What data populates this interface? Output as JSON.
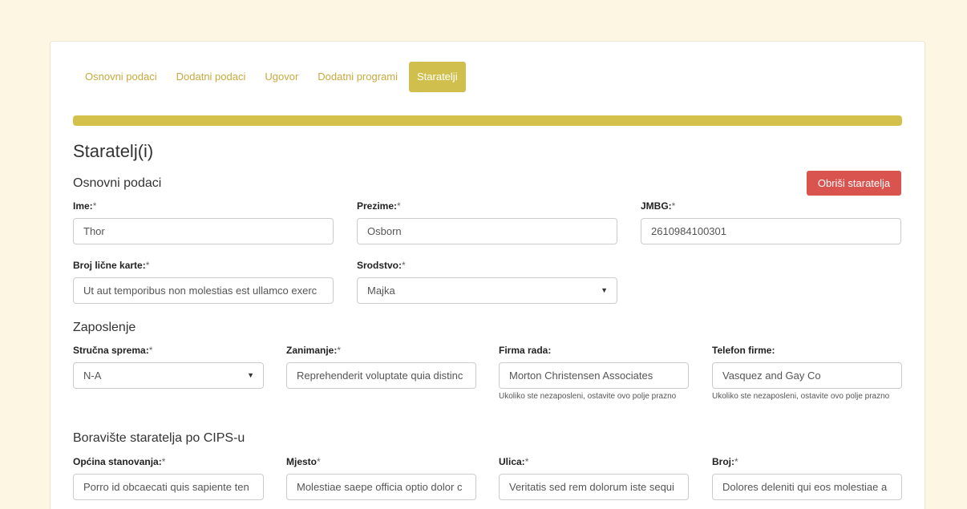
{
  "tabs": [
    {
      "label": "Osnovni podaci"
    },
    {
      "label": "Dodatni podaci"
    },
    {
      "label": "Ugovor"
    },
    {
      "label": "Dodatni programi"
    },
    {
      "label": "Staratelji"
    }
  ],
  "progress": {
    "value": 1.0
  },
  "page_title": "Staratelj(i)",
  "sections": {
    "basic": {
      "title": "Osnovni podaci",
      "delete_button": "Obriši staratelja",
      "ime": {
        "label": "Ime:",
        "req": "*",
        "value": "Thor"
      },
      "prezime": {
        "label": "Prezime:",
        "req": "*",
        "value": "Osborn"
      },
      "jmbg": {
        "label": "JMBG:",
        "req": "*",
        "value": "2610984100301"
      },
      "broj_licne": {
        "label": "Broj lične karte:",
        "req": "*",
        "value": "Ut aut temporibus non molestias est ullamco exerc"
      },
      "srodstvo": {
        "label": "Srodstvo:",
        "req": "*",
        "value": "Majka"
      }
    },
    "employment": {
      "title": "Zaposlenje",
      "strucna": {
        "label": "Stručna sprema:",
        "req": "*",
        "value": "N-A"
      },
      "zanimanje": {
        "label": "Zanimanje:",
        "req": "*",
        "value": "Reprehenderit voluptate quia distinc"
      },
      "firma": {
        "label": "Firma rada:",
        "value": "Morton Christensen Associates",
        "help": "Ukoliko ste nezaposleni, ostavite ovo polje prazno"
      },
      "telefon": {
        "label": "Telefon firme:",
        "value": "Vasquez and Gay Co",
        "help": "Ukoliko ste nezaposleni, ostavite ovo polje prazno"
      }
    },
    "residence": {
      "title": "Boravište staratelja po CIPS-u",
      "opcina": {
        "label": "Općina stanovanja:",
        "req": "*",
        "value": "Porro id obcaecati quis sapiente ten"
      },
      "mjesto": {
        "label": "Mjesto",
        "req": "*",
        "value": "Molestiae saepe officia optio dolor c"
      },
      "ulica": {
        "label": "Ulica:",
        "req": "*",
        "value": "Veritatis sed rem dolorum iste sequi"
      },
      "broj": {
        "label": "Broj:",
        "req": "*",
        "value": "Dolores deleniti qui eos molestiae a"
      }
    }
  },
  "colors": {
    "accent": "#d1bf4d",
    "tab_text": "#c9a93e",
    "danger": "#d9534f",
    "page_bg": "#fdf6e3"
  },
  "icons": {
    "select_caret": "▼"
  }
}
